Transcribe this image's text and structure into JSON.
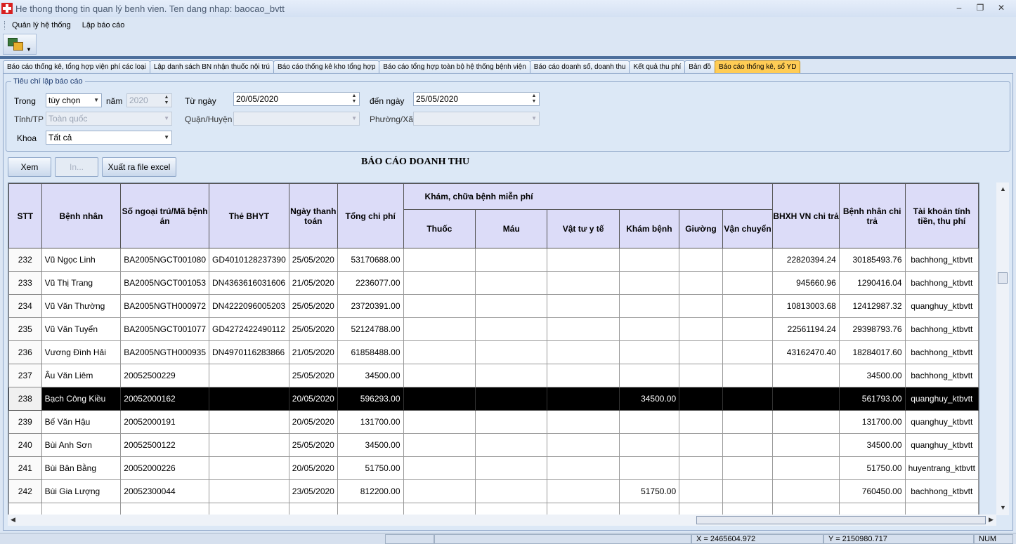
{
  "window": {
    "title": "He thong thong tin quan lý benh vien. Ten dang nhap: baocao_bvtt"
  },
  "menu": {
    "items": [
      "Quản lý hệ thống",
      "Lập báo cáo"
    ]
  },
  "tabs": [
    "Báo cáo thống kê, tổng hợp viện phí các loại",
    "Lập danh sách BN nhận thuốc nội trú",
    "Báo cáo thống kê kho tổng hợp",
    "Báo cáo tổng hợp toàn bộ hệ thống bệnh viện",
    "Báo cáo doanh số, doanh thu",
    "Kết quả thu phí",
    "Bản đồ",
    "Báo cáo thống kê, sổ YD"
  ],
  "criteria": {
    "legend": "Tiêu chí lập báo cáo",
    "trong_label": "Trong",
    "trong_value": "tùy chọn",
    "nam_label": "năm",
    "nam_value": "2020",
    "tu_ngay_label": "Từ ngày",
    "tu_ngay_value": "20/05/2020",
    "den_ngay_label": "đến ngày",
    "den_ngay_value": "25/05/2020",
    "tinh_label": "Tỉnh/TP",
    "tinh_value": "Toàn quốc",
    "quan_label": "Quận/Huyện",
    "phuong_label": "Phường/Xã",
    "khoa_label": "Khoa",
    "khoa_value": "Tất cả"
  },
  "buttons": {
    "xem": "Xem",
    "in": "In...",
    "excel": "Xuất ra file excel"
  },
  "report_title": "BÁO CÁO DOANH THU",
  "table": {
    "headers": {
      "stt": "STT",
      "benh_nhan": "Bệnh nhân",
      "so_ngoai_tru": "Số ngoại trú/Mã bệnh án",
      "the_bhyt": "Thẻ BHYT",
      "ngay_tt": "Ngày thanh toán",
      "tong_chi_phi": "Tổng chi phí",
      "kham_chua_group": "Khám, chữa bệnh miễn phí",
      "thuoc": "Thuốc",
      "mau": "Máu",
      "vat_tu": "Vật tư y tế",
      "kham_benh": "Khám bệnh",
      "giuong": "Giường",
      "van_chuyen": "Vận chuyển",
      "bhxh": "BHXH VN chi trả",
      "bn_chi_tra": "Bệnh nhân chi trả",
      "tai_khoan": "Tài khoản tính tiền, thu phí"
    },
    "rows": [
      {
        "stt": "232",
        "ten": "Vũ Ngọc Linh",
        "so": "BA2005NGCT001080",
        "the": "GD4010128237390",
        "ngay": "25/05/2020",
        "tong": "53170688.00",
        "thuoc": "",
        "mau": "",
        "vattu": "",
        "kham": "",
        "giuong": "",
        "vanchuyen": "",
        "bhxh": "22820394.24",
        "bn": "30185493.76",
        "tk": "bachhong_ktbvtt"
      },
      {
        "stt": "233",
        "ten": "Vũ Thị Trang",
        "so": "BA2005NGCT001053",
        "the": "DN4363616031606",
        "ngay": "21/05/2020",
        "tong": "2236077.00",
        "thuoc": "",
        "mau": "",
        "vattu": "",
        "kham": "",
        "giuong": "",
        "vanchuyen": "",
        "bhxh": "945660.96",
        "bn": "1290416.04",
        "tk": "bachhong_ktbvtt"
      },
      {
        "stt": "234",
        "ten": "Vũ Văn Thường",
        "so": "BA2005NGTH000972",
        "the": "DN4222096005203",
        "ngay": "25/05/2020",
        "tong": "23720391.00",
        "thuoc": "",
        "mau": "",
        "vattu": "",
        "kham": "",
        "giuong": "",
        "vanchuyen": "",
        "bhxh": "10813003.68",
        "bn": "12412987.32",
        "tk": "quanghuy_ktbvtt"
      },
      {
        "stt": "235",
        "ten": "Vũ Văn Tuyển",
        "so": "BA2005NGCT001077",
        "the": "GD4272422490112",
        "ngay": "25/05/2020",
        "tong": "52124788.00",
        "thuoc": "",
        "mau": "",
        "vattu": "",
        "kham": "",
        "giuong": "",
        "vanchuyen": "",
        "bhxh": "22561194.24",
        "bn": "29398793.76",
        "tk": "bachhong_ktbvtt"
      },
      {
        "stt": "236",
        "ten": "Vương Đình Hải",
        "so": "BA2005NGTH000935",
        "the": "DN4970116283866",
        "ngay": "21/05/2020",
        "tong": "61858488.00",
        "thuoc": "",
        "mau": "",
        "vattu": "",
        "kham": "",
        "giuong": "",
        "vanchuyen": "",
        "bhxh": "43162470.40",
        "bn": "18284017.60",
        "tk": "bachhong_ktbvtt"
      },
      {
        "stt": "237",
        "ten": "Âu Văn Liêm",
        "so": "20052500229",
        "the": "",
        "ngay": "25/05/2020",
        "tong": "34500.00",
        "thuoc": "",
        "mau": "",
        "vattu": "",
        "kham": "",
        "giuong": "",
        "vanchuyen": "",
        "bhxh": "",
        "bn": "34500.00",
        "tk": "bachhong_ktbvtt"
      },
      {
        "stt": "238",
        "ten": "Bạch Công Kiều",
        "so": "20052000162",
        "the": "",
        "ngay": "20/05/2020",
        "tong": "596293.00",
        "thuoc": "",
        "mau": "",
        "vattu": "",
        "kham": "34500.00",
        "giuong": "",
        "vanchuyen": "",
        "bhxh": "",
        "bn": "561793.00",
        "tk": "quanghuy_ktbvtt",
        "selected": true
      },
      {
        "stt": "239",
        "ten": "Bế Văn Hậu",
        "so": "20052000191",
        "the": "",
        "ngay": "20/05/2020",
        "tong": "131700.00",
        "thuoc": "",
        "mau": "",
        "vattu": "",
        "kham": "",
        "giuong": "",
        "vanchuyen": "",
        "bhxh": "",
        "bn": "131700.00",
        "tk": "quanghuy_ktbvtt"
      },
      {
        "stt": "240",
        "ten": "Bùi Anh Sơn",
        "so": "20052500122",
        "the": "",
        "ngay": "25/05/2020",
        "tong": "34500.00",
        "thuoc": "",
        "mau": "",
        "vattu": "",
        "kham": "",
        "giuong": "",
        "vanchuyen": "",
        "bhxh": "",
        "bn": "34500.00",
        "tk": "quanghuy_ktbvtt"
      },
      {
        "stt": "241",
        "ten": "Bùi Bân Bằng",
        "so": "20052000226",
        "the": "",
        "ngay": "20/05/2020",
        "tong": "51750.00",
        "thuoc": "",
        "mau": "",
        "vattu": "",
        "kham": "",
        "giuong": "",
        "vanchuyen": "",
        "bhxh": "",
        "bn": "51750.00",
        "tk": "huyentrang_ktbvtt"
      },
      {
        "stt": "242",
        "ten": "Bùi Gia Lượng",
        "so": "20052300044",
        "the": "",
        "ngay": "23/05/2020",
        "tong": "812200.00",
        "thuoc": "",
        "mau": "",
        "vattu": "",
        "kham": "51750.00",
        "giuong": "",
        "vanchuyen": "",
        "bhxh": "",
        "bn": "760450.00",
        "tk": "bachhong_ktbvtt"
      }
    ]
  },
  "status": {
    "x": "X = 2465604.972",
    "y": "Y = 2150980.717",
    "num": "NUM"
  }
}
